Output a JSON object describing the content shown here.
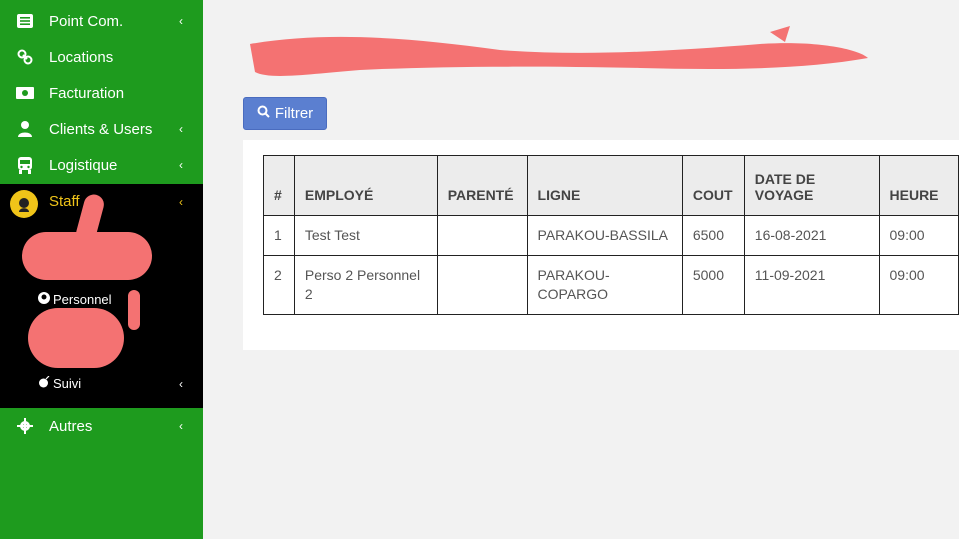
{
  "sidebar": {
    "items": [
      {
        "label": "Point Com.",
        "icon": "list-icon",
        "has_chevron": true
      },
      {
        "label": "Locations",
        "icon": "link-icon",
        "has_chevron": false
      },
      {
        "label": "Facturation",
        "icon": "money-icon",
        "has_chevron": false
      },
      {
        "label": "Clients & Users",
        "icon": "user-icon",
        "has_chevron": true
      },
      {
        "label": "Logistique",
        "icon": "bus-icon",
        "has_chevron": true
      }
    ],
    "staff": {
      "label": "Staff",
      "chevron": "‹"
    },
    "submenu": {
      "personnel": "Personnel",
      "suivi": "Suivi"
    },
    "autres": {
      "label": "Autres"
    },
    "chevron": "‹"
  },
  "toolbar": {
    "filter_label": "Filtrer"
  },
  "table": {
    "headers": [
      "#",
      "EMPLOYÉ",
      "PARENTÉ",
      "LIGNE",
      "COUT",
      "DATE DE VOYAGE",
      "HEURE"
    ],
    "rows": [
      [
        "1",
        "Test Test",
        "",
        "PARAKOU-BASSILA",
        "6500",
        "16-08-2021",
        "09:00"
      ],
      [
        "2",
        "Perso 2 Personnel 2",
        "",
        "PARAKOU-COPARGO",
        "5000",
        "11-09-2021",
        "09:00"
      ]
    ]
  },
  "colors": {
    "sidebar": "#1e9b1e",
    "staff_bg": "#000000",
    "accent": "#f0c419",
    "button": "#5b7fd0",
    "redaction": "#f47272"
  }
}
